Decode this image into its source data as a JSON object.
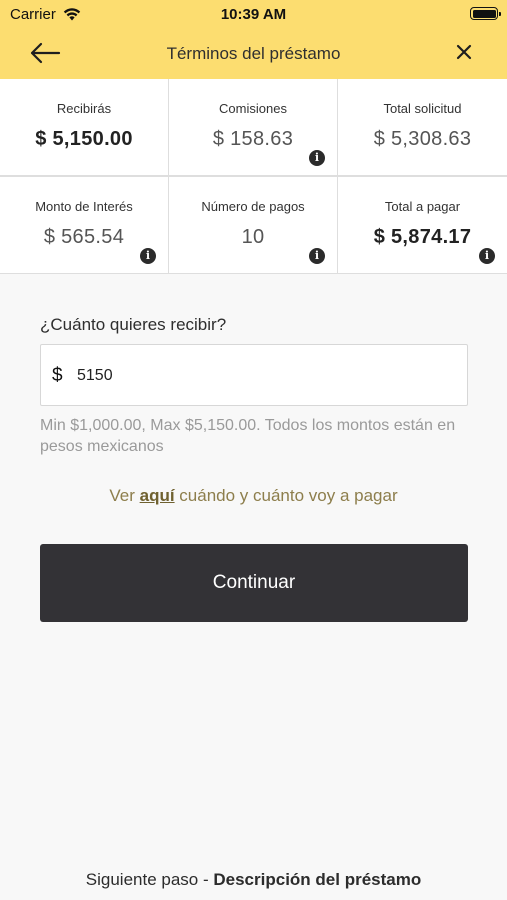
{
  "status_bar": {
    "carrier": "Carrier",
    "time": "10:39 AM"
  },
  "nav": {
    "title": "Términos del préstamo"
  },
  "summary": [
    {
      "label": "Recibirás",
      "value": "$ 5,150.00",
      "emphasis": true,
      "info": false
    },
    {
      "label": "Comisiones",
      "value": "$ 158.63",
      "emphasis": false,
      "info": true
    },
    {
      "label": "Total solicitud",
      "value": "$ 5,308.63",
      "emphasis": false,
      "info": false
    },
    {
      "label": "Monto de Interés",
      "value": "$ 565.54",
      "emphasis": false,
      "info": true
    },
    {
      "label": "Número de pagos",
      "value": "10",
      "emphasis": false,
      "info": true
    },
    {
      "label": "Total a pagar",
      "value": "$ 5,874.17",
      "emphasis": true,
      "info": true
    }
  ],
  "form": {
    "question": "¿Cuánto quieres recibir?",
    "currency_symbol": "$",
    "amount_value": "5150",
    "hint": "Min $1,000.00, Max $5,150.00. Todos los montos están en pesos mexicanos"
  },
  "schedule_link": {
    "prefix": "Ver ",
    "link_text": "aquí",
    "suffix": " cuándo y cuánto voy a pagar"
  },
  "continue_label": "Continuar",
  "footer": {
    "prefix": "Siguiente paso - ",
    "step": "Descripción del préstamo"
  },
  "icons": {
    "info": "i"
  },
  "colors": {
    "header": "#fcdd70",
    "button": "#333236",
    "link": "#8d7e4c"
  }
}
